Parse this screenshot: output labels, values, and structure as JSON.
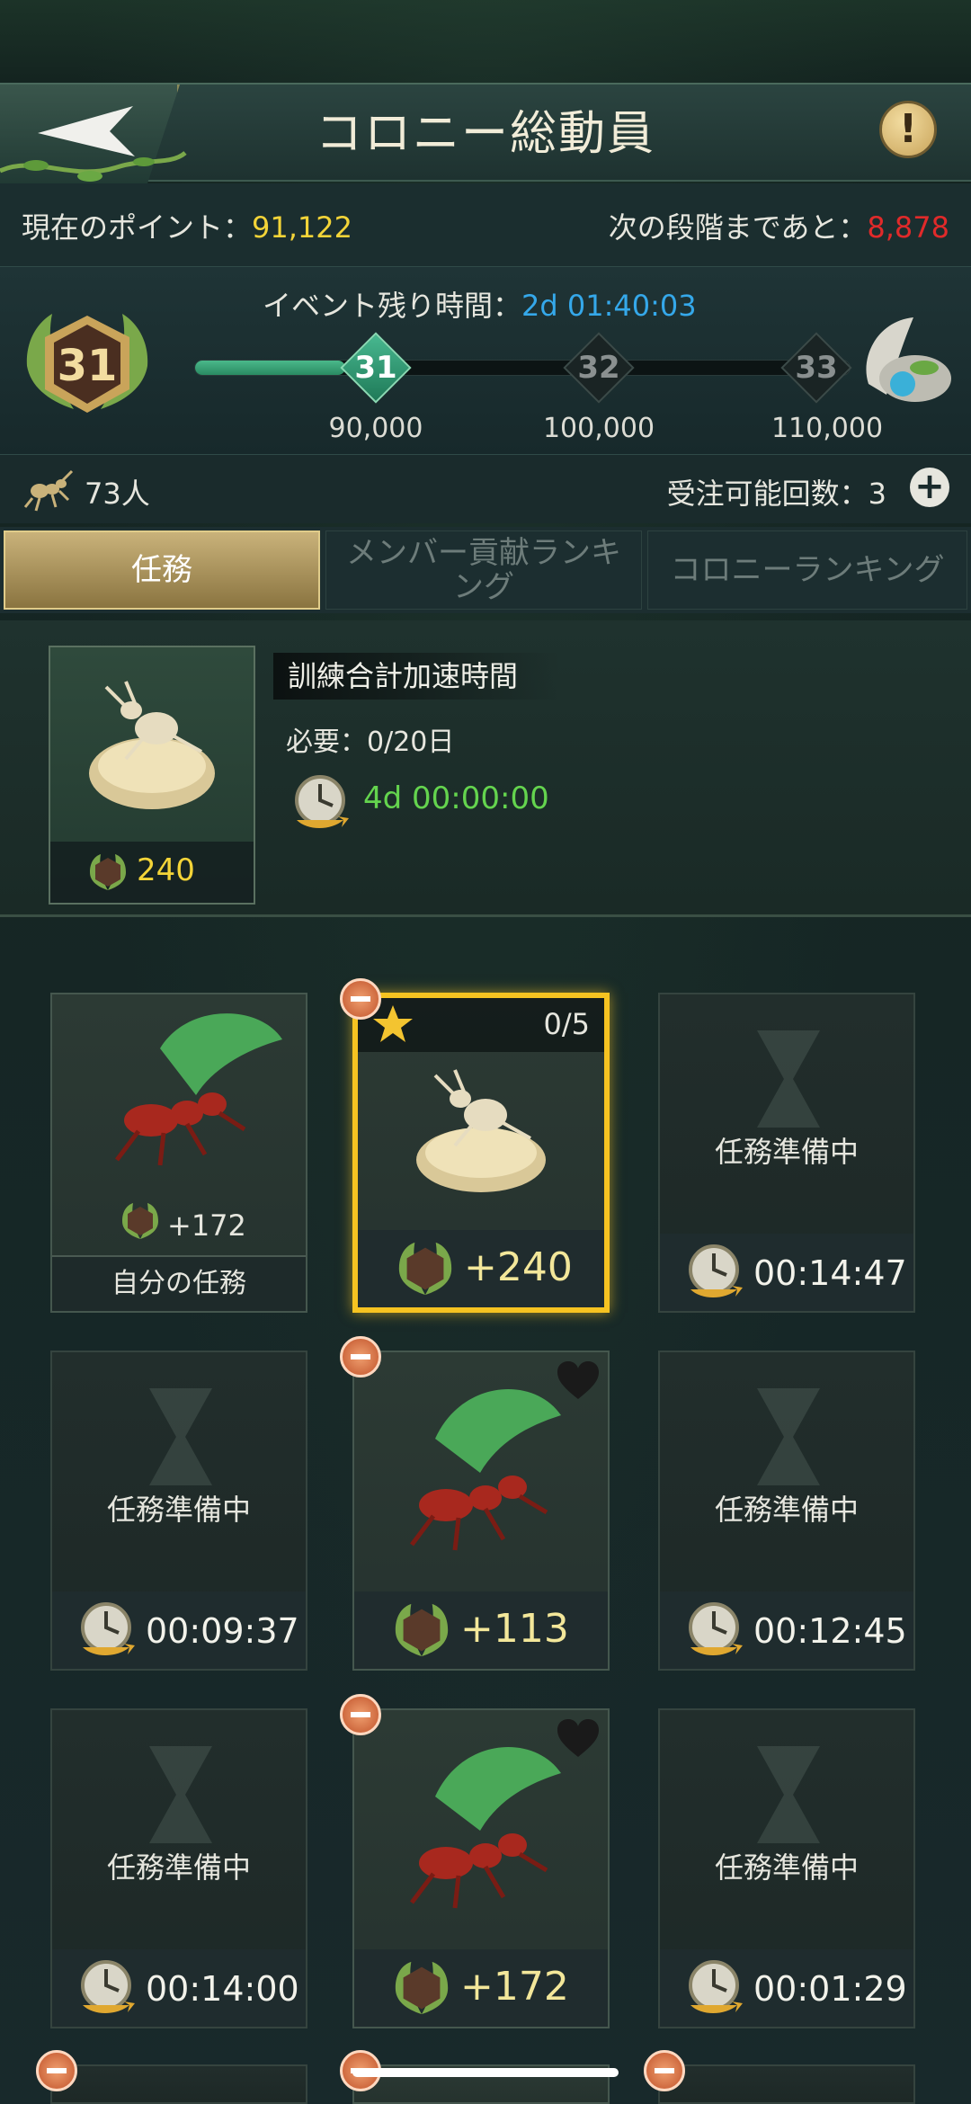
{
  "header": {
    "title": "コロニー総動員"
  },
  "points": {
    "current_label": "現在のポイント：",
    "current_value": "91,122",
    "next_label": "次の段階まであと：",
    "next_value": "8,878"
  },
  "progress": {
    "event_label": "イベント残り時間：",
    "event_time": "2d 01:40:03",
    "level": "31",
    "fill_fraction": 0.23,
    "stages": [
      {
        "label": "31",
        "value": "90,000",
        "active": true
      },
      {
        "label": "32",
        "value": "100,000",
        "active": false
      },
      {
        "label": "33",
        "value": "110,000",
        "active": false
      }
    ]
  },
  "members": {
    "count": "73人",
    "orders_label": "受注可能回数：3"
  },
  "tabs": [
    {
      "label": "任務",
      "active": true
    },
    {
      "label": "メンバー貢献ランキング",
      "active": false
    },
    {
      "label": "コロニーランキング",
      "active": false
    }
  ],
  "current_task": {
    "name": "訓練合計加速時間",
    "requirement": "必要：0/20日",
    "timer": "4d 00:00:00",
    "points": "240"
  },
  "grid": {
    "own": {
      "points": "+172",
      "label": "自分の任務"
    },
    "selected": {
      "count": "0/5",
      "points": "+240"
    },
    "preparing": "任務準備中",
    "timers": [
      "00:14:47",
      "00:09:37",
      "00:12:45",
      "00:14:00",
      "00:01:29"
    ],
    "rewards": [
      "+113",
      "+172"
    ]
  },
  "colors": {
    "accent": "#f3d438",
    "warn": "#e02a2a",
    "time": "#35a8ea",
    "timer_green": "#64d44e",
    "selected_border": "#f6c321"
  }
}
